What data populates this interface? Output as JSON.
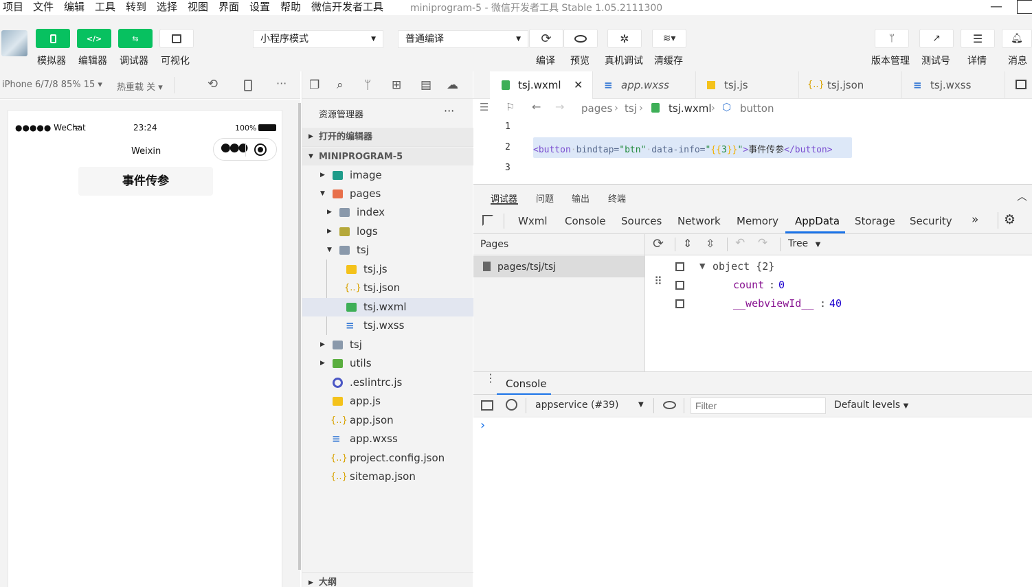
{
  "menu": [
    "项目",
    "文件",
    "编辑",
    "工具",
    "转到",
    "选择",
    "视图",
    "界面",
    "设置",
    "帮助",
    "微信开发者工具"
  ],
  "window_title": "miniprogram-5 - 微信开发者工具 Stable 1.05.2111300",
  "toolbar": {
    "simulator": "模拟器",
    "editor": "编辑器",
    "debugger": "调试器",
    "visual": "可视化",
    "mode_select": "小程序模式",
    "compile_select": "普通编译",
    "compile": "编译",
    "preview": "预览",
    "remote_debug": "真机调试",
    "clear_cache": "清缓存",
    "version": "版本管理",
    "test_account": "测试号",
    "details": "详情",
    "messages": "消息"
  },
  "simulator": {
    "device": "iPhone 6/7/8 85% 15",
    "hot_reload": "热重载 关",
    "status_left": "●●●●● WeChat",
    "time": "23:24",
    "battery": "100%",
    "nav_title": "Weixin",
    "button_label": "事件传参"
  },
  "explorer": {
    "title": "资源管理器",
    "more": "···",
    "open_editors": "打开的编辑器",
    "project": "MINIPROGRAM-5",
    "outline": "大纲",
    "items": [
      {
        "name": "image"
      },
      {
        "name": "pages"
      },
      {
        "name": "index"
      },
      {
        "name": "logs"
      },
      {
        "name": "tsj"
      },
      {
        "name": "tsj.js"
      },
      {
        "name": "tsj.json"
      },
      {
        "name": "tsj.wxml"
      },
      {
        "name": "tsj.wxss"
      },
      {
        "name": "tsj"
      },
      {
        "name": "utils"
      },
      {
        "name": ".eslintrc.js"
      },
      {
        "name": "app.js"
      },
      {
        "name": "app.json"
      },
      {
        "name": "app.wxss"
      },
      {
        "name": "project.config.json"
      },
      {
        "name": "sitemap.json"
      }
    ]
  },
  "editor": {
    "tabs": [
      "tsj.wxml",
      "app.wxss",
      "tsj.js",
      "tsj.json",
      "tsj.wxss"
    ],
    "breadcrumb": [
      "pages",
      "tsj",
      "tsj.wxml",
      "button"
    ],
    "line_numbers": [
      "1",
      "2",
      "3"
    ],
    "code": {
      "open_tag": "<button",
      "attr1_name": "bindtap=",
      "attr1_value": "\"btn\"",
      "attr2_name": "data-info=",
      "attr2_value_open": "\"",
      "attr2_mustache_open": "{{",
      "attr2_value_inner": "3",
      "attr2_mustache_close": "}}",
      "attr2_value_close": "\"",
      "tag_close_bracket": ">",
      "text": "事件传参",
      "close_tag": "</button>"
    }
  },
  "devtools": {
    "top_tabs": [
      "调试器",
      "问题",
      "输出",
      "终端"
    ],
    "tabs": [
      "Wxml",
      "Console",
      "Sources",
      "Network",
      "Memory",
      "AppData",
      "Storage",
      "Security"
    ],
    "active_tab": "AppData",
    "pages_label": "Pages",
    "page_item": "pages/tsj/tsj",
    "view_mode": "Tree",
    "object_label": "object {2}",
    "fields": [
      {
        "key": "count",
        "value": "0"
      },
      {
        "key": "__webviewId__",
        "value": "40"
      }
    ]
  },
  "console": {
    "tab": "Console",
    "context": "appservice (#39)",
    "filter_placeholder": "Filter",
    "levels": "Default levels",
    "prompt": "›"
  },
  "colors": {
    "accent_green": "#07c160",
    "tab_active_blue": "#1a73e8"
  }
}
